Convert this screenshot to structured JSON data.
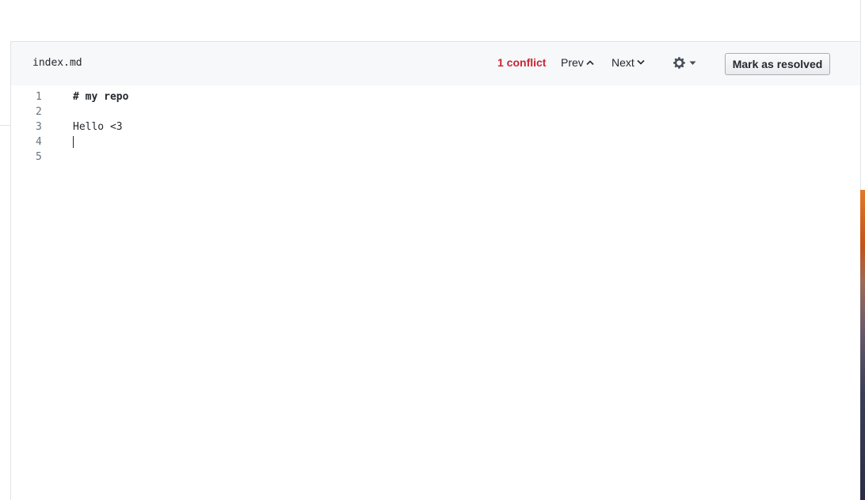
{
  "toolbar": {
    "filename": "index.md",
    "conflict_count": "1 conflict",
    "prev_label": "Prev",
    "next_label": "Next",
    "resolve_label": "Mark as resolved"
  },
  "editor": {
    "lines": [
      {
        "number": "1",
        "text": "# my repo"
      },
      {
        "number": "2",
        "text": ""
      },
      {
        "number": "3",
        "text": "Hello <3"
      },
      {
        "number": "4",
        "text": ""
      },
      {
        "number": "5",
        "text": ""
      }
    ]
  },
  "colors": {
    "conflict": "#cb2431",
    "toolbar_bg": "#f6f8fa",
    "border": "#e1e4e8",
    "text": "#24292e",
    "line_number": "#6a737d"
  },
  "icons": {
    "prev": "chevron-up-icon",
    "next": "chevron-down-icon",
    "settings": "gear-icon",
    "settings_caret": "caret-down-icon"
  }
}
